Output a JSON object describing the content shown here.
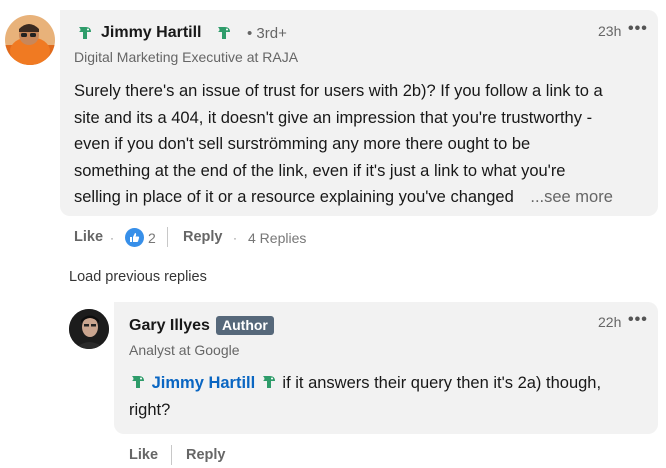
{
  "comment": {
    "author_name": "Jimmy Hartill",
    "degree": "• 3rd+",
    "headline": "Digital Marketing Executive at RAJA",
    "time": "23h",
    "body_lines": [
      "Surely there's an issue of trust for users with 2b)? If you follow a link to a",
      "site and its a 404, it doesn't give an impression that you're trustworthy -",
      "even if you don't sell surströmming any more there ought to be",
      "something at the end of the link, even if it's just a link to what you're",
      "selling in place of it or a resource explaining you've changed"
    ],
    "see_more": "...see more",
    "like_label": "Like",
    "reaction_count": "2",
    "reply_label": "Reply",
    "replies_count": "4 Replies"
  },
  "load_previous": "Load previous replies",
  "reply": {
    "author_name": "Gary Illyes",
    "author_badge": "Author",
    "headline": "Analyst at Google",
    "time": "22h",
    "mention": "Jimmy Hartill",
    "text_after_mention": "if it answers their query then it's 2a) though,",
    "text_line2": "right?",
    "like_label": "Like",
    "reply_label": "Reply"
  },
  "colors": {
    "bubble": "#f2f2f2",
    "mention": "#0a66c2",
    "badge": "#56687a",
    "reaction": "#378fe9",
    "green_icon": "#2e9c6a"
  },
  "icons": {
    "more": "ellipsis-icon",
    "badge": "green-fish-icon",
    "reaction": "like-reaction-icon"
  }
}
